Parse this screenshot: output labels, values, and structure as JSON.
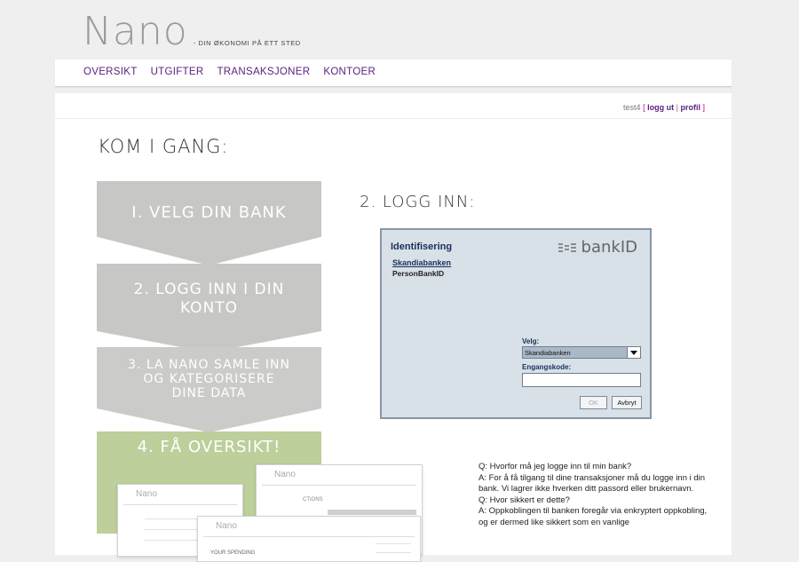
{
  "brand": {
    "name": "Nano",
    "tagline": "- DIN ØKONOMI PÅ ETT STED"
  },
  "nav": {
    "items": [
      "OVERSIKT",
      "UTGIFTER",
      "TRANSAKSJONER",
      "KONTOER"
    ]
  },
  "userbar": {
    "username": "test4",
    "open": "[",
    "logout": "logg ut",
    "sep": "|",
    "profile": "profil",
    "close": "]"
  },
  "page": {
    "title": "KOM I GANG:"
  },
  "steps": {
    "s1": "I. VELG DIN BANK",
    "s2a": "2. LOGG INN I DIN",
    "s2b": "KONTO",
    "s3a": "3. LA NANO SAMLE INN",
    "s3b": "OG KATEGORISERE",
    "s3c": "DINE DATA",
    "s4": "4. FÅ OVERSIKT!"
  },
  "preview": {
    "logo": "Nano",
    "heading": "YOUR SPENDING",
    "transactions": "CTIONS"
  },
  "login": {
    "title": "2. LOGG INN:",
    "dialog": {
      "heading": "Identifisering",
      "bank_link": "Skandiabanken",
      "bank_sub": "PersonBankID",
      "logo_text": "bankID",
      "velg_label": "Velg:",
      "selected": "Skandiabanken",
      "code_label": "Engangskode:",
      "ok": "OK",
      "cancel": "Avbryt"
    }
  },
  "faq": [
    "Q: Hvorfor må jeg logge inn til min bank?",
    "A: For å få tilgang til dine transaksjoner må du logge inn i din bank. Vi lagrer ikke hverken ditt passord eller brukernavn.",
    "Q: Hvor sikkert er dette?",
    "A: Oppkoblingen til banken foregår via enkryptert oppkobling, og er dermed like sikkert som en vanlige"
  ],
  "colors": {
    "nav_link": "#5a1e7e",
    "step_gray": "#c7c7c5",
    "step_green": "#bdcf9b",
    "bankid_bg": "#d8e0e8"
  }
}
